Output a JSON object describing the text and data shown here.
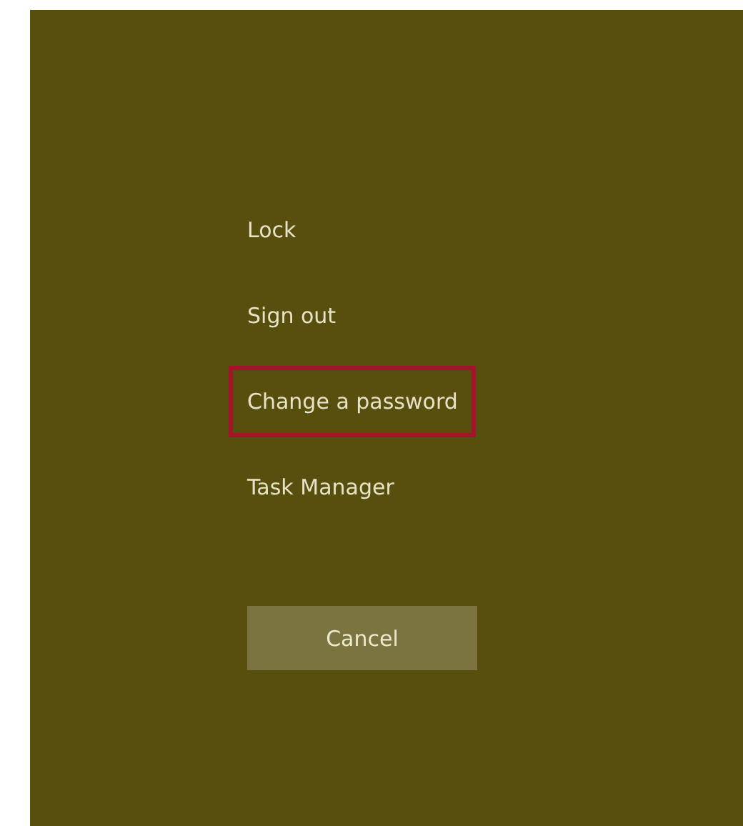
{
  "menu": [
    {
      "label": "Lock",
      "highlighted": false
    },
    {
      "label": "Sign out",
      "highlighted": false
    },
    {
      "label": "Change a password",
      "highlighted": true
    },
    {
      "label": "Task Manager",
      "highlighted": false
    }
  ],
  "cancel_button": {
    "label": "Cancel"
  }
}
